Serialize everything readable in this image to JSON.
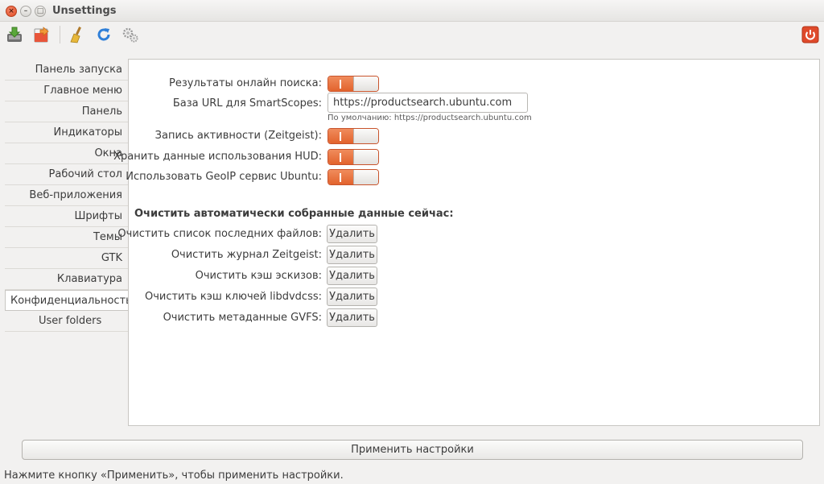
{
  "window": {
    "title": "Unsettings",
    "close_glyph": "×",
    "min_glyph": "–",
    "max_glyph": "□"
  },
  "toolbar": {
    "icons": [
      "import-icon",
      "export-icon",
      "broom-icon",
      "refresh-icon",
      "gears-icon",
      "power-icon"
    ]
  },
  "sidebar": {
    "items": [
      {
        "label": "Панель запуска"
      },
      {
        "label": "Главное меню"
      },
      {
        "label": "Панель"
      },
      {
        "label": "Индикаторы"
      },
      {
        "label": "Окна"
      },
      {
        "label": "Рабочий стол"
      },
      {
        "label": "Веб-приложения"
      },
      {
        "label": "Шрифты"
      },
      {
        "label": "Темы"
      },
      {
        "label": "GTK"
      },
      {
        "label": "Клавиатура"
      },
      {
        "label": "Конфиденциальность"
      },
      {
        "label": "User folders"
      }
    ],
    "active_index": 11
  },
  "privacy": {
    "online_search_label": "Результаты онлайн поиска:",
    "smartscopes_label": "База URL для SmartScopes:",
    "smartscopes_value": "https://productsearch.ubuntu.com",
    "smartscopes_hint": "По умолчанию: https://productsearch.ubuntu.com",
    "zeitgeist_label": "Запись активности (Zeitgeist):",
    "hud_label": "Хранить данные использования HUD:",
    "geoip_label": "Использовать GeoIP сервис Ubuntu:",
    "toggles": {
      "online_search": true,
      "zeitgeist": true,
      "hud": true,
      "geoip": true
    },
    "clear_section_title": "Очистить автоматически собранные данные сейчас:",
    "clear_rows": [
      {
        "label": "Очистить  список последних файлов:",
        "button": "Удалить"
      },
      {
        "label": "Очистить журнал Zeitgeist:",
        "button": "Удалить"
      },
      {
        "label": "Очистить кэш эскизов:",
        "button": "Удалить"
      },
      {
        "label": "Очистить кэш ключей libdvdcss:",
        "button": "Удалить"
      },
      {
        "label": "Очистить метаданные GVFS:",
        "button": "Удалить"
      }
    ]
  },
  "footer": {
    "apply_label": "Применить настройки",
    "status_text": "Нажмите кнопку «Применить», чтобы применить настройки."
  },
  "colors": {
    "accent": "#e8632d",
    "power": "#df4a2b"
  }
}
